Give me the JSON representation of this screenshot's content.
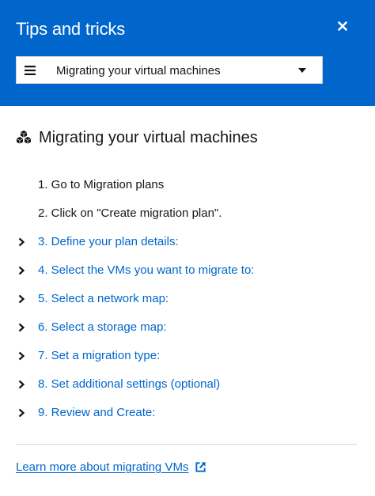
{
  "header": {
    "title": "Tips and tricks",
    "close_icon": "close-icon",
    "background_color": "#0066cc"
  },
  "topic_select": {
    "value": "Migrating your virtual machines",
    "leading_icon": "menu-icon",
    "trailing_icon": "caret-down-icon"
  },
  "section": {
    "icon": "cubes-icon",
    "title": "Migrating your virtual machines"
  },
  "steps": [
    {
      "label": "1. Go to Migration plans",
      "expandable": false
    },
    {
      "label": "2. Click on \"Create migration plan\".",
      "expandable": false
    },
    {
      "label": "3. Define your plan details:",
      "expandable": true
    },
    {
      "label": "4. Select the VMs you want to migrate to:",
      "expandable": true
    },
    {
      "label": "5. Select a network map:",
      "expandable": true
    },
    {
      "label": "6. Select a storage map:",
      "expandable": true
    },
    {
      "label": "7. Set a migration type:",
      "expandable": true
    },
    {
      "label": "8. Set additional settings (optional)",
      "expandable": true
    },
    {
      "label": "9. Review and Create:",
      "expandable": true
    }
  ],
  "footer": {
    "learn_more_label": "Learn more about migrating VMs",
    "learn_more_icon": "external-link-icon"
  },
  "colors": {
    "link": "#0066cc",
    "text": "#151515",
    "divider": "#d2d2d2"
  }
}
